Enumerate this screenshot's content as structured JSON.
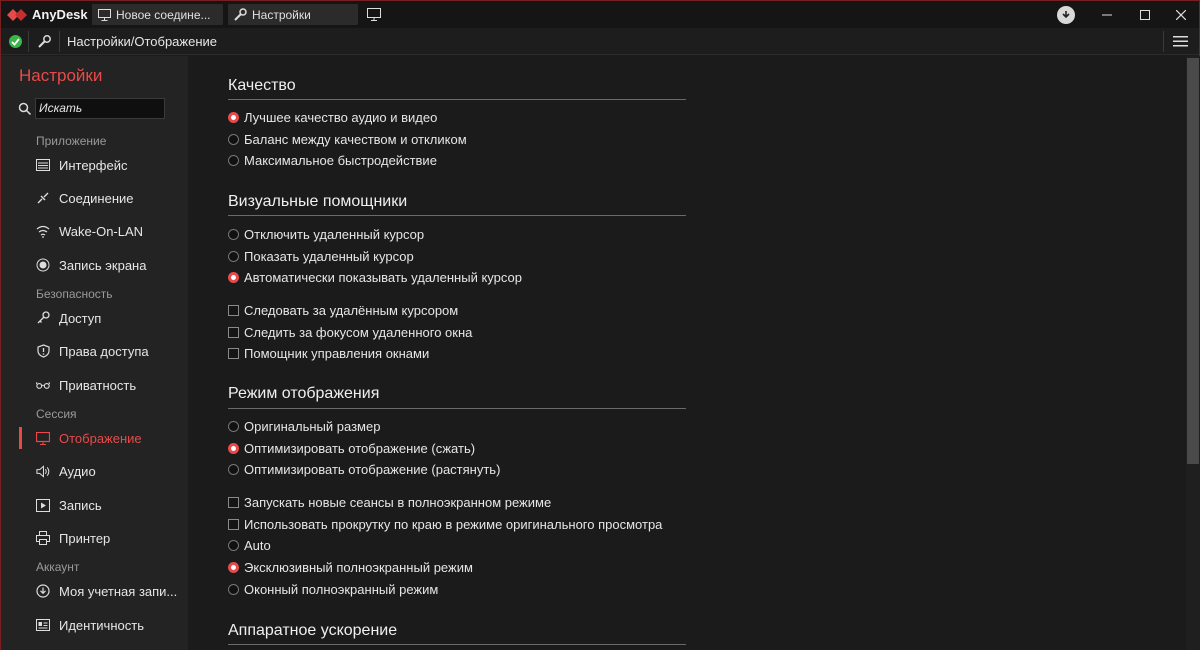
{
  "app": {
    "name": "AnyDesk",
    "accent": "#e84a4a",
    "ok_color": "#3bb54a"
  },
  "tabs": [
    {
      "label": "Новое соедине...",
      "icon": "monitor-icon"
    },
    {
      "label": "Настройки",
      "icon": "wrench-icon"
    }
  ],
  "address": {
    "path": "Настройки/Отображение"
  },
  "sidebar": {
    "title": "Настройки",
    "search": {
      "value": "Искать"
    },
    "sections": {
      "app": "Приложение",
      "security": "Безопасность",
      "session": "Сессия",
      "account": "Аккаунт"
    },
    "items": [
      {
        "label": "Интерфейс",
        "icon": "interface-icon"
      },
      {
        "label": "Соединение",
        "icon": "connection-icon"
      },
      {
        "label": "Wake-On-LAN",
        "icon": "wifi-icon"
      },
      {
        "label": "Запись экрана",
        "icon": "record-icon"
      },
      {
        "label": "Доступ",
        "icon": "key-icon"
      },
      {
        "label": "Права доступа",
        "icon": "shield-icon"
      },
      {
        "label": "Приватность",
        "icon": "glasses-icon"
      },
      {
        "label": "Отображение",
        "icon": "monitor-icon",
        "active": true
      },
      {
        "label": "Аудио",
        "icon": "speaker-icon"
      },
      {
        "label": "Запись",
        "icon": "play-icon"
      },
      {
        "label": "Принтер",
        "icon": "printer-icon"
      },
      {
        "label": "Моя учетная запи...",
        "icon": "download-circle-icon"
      },
      {
        "label": "Идентичность",
        "icon": "id-card-icon"
      }
    ]
  },
  "main": {
    "quality": {
      "heading": "Качество",
      "options": [
        {
          "label": "Лучшее качество аудио и видео",
          "selected": true
        },
        {
          "label": "Баланс между качеством и откликом",
          "selected": false
        },
        {
          "label": "Максимальное быстродействие",
          "selected": false
        }
      ]
    },
    "visual": {
      "heading": "Визуальные помощники",
      "options": [
        {
          "label": "Отключить удаленный курсор",
          "selected": false
        },
        {
          "label": "Показать удаленный курсор",
          "selected": false
        },
        {
          "label": "Автоматически показывать удаленный курсор",
          "selected": true
        }
      ],
      "checks": [
        {
          "label": "Следовать за удалённым курсором",
          "checked": false
        },
        {
          "label": "Следить за фокусом удаленного окна",
          "checked": false
        },
        {
          "label": "Помощник управления окнами",
          "checked": false
        }
      ]
    },
    "display": {
      "heading": "Режим отображения",
      "options": [
        {
          "label": "Оригинальный размер",
          "selected": false
        },
        {
          "label": "Оптимизировать отображение (сжать)",
          "selected": true
        },
        {
          "label": "Оптимизировать отображение (растянуть)",
          "selected": false
        }
      ],
      "checks": [
        {
          "label": "Запускать новые сеансы в полноэкранном режиме",
          "checked": false
        },
        {
          "label": "Использовать прокрутку по краю в режиме оригинального просмотра",
          "checked": false
        }
      ],
      "fullscreen": [
        {
          "label": "Auto",
          "selected": false
        },
        {
          "label": "Эксклюзивный полноэкранный режим",
          "selected": true
        },
        {
          "label": "Оконный полноэкранный режим",
          "selected": false
        }
      ]
    },
    "hardware": {
      "heading": "Аппаратное ускорение"
    }
  }
}
